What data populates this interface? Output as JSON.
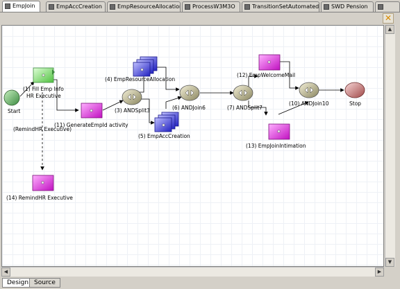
{
  "tabs": [
    {
      "label": "EmpJoin",
      "active": true
    },
    {
      "label": "EmpAccCreation"
    },
    {
      "label": "EmpResourceAllocation"
    },
    {
      "label": "ProcessW3M3O"
    },
    {
      "label": "TransitionSetAutomated"
    },
    {
      "label": "SWD Pension"
    }
  ],
  "close_label": "✕",
  "nodes": {
    "start": "Start",
    "fill": "(1) Fill Emp Info\nHR Executive",
    "gen": "(11) GenerateEmpId activity",
    "andsplit3": "(3) ANDSplit3",
    "res": "(4) EmpResourceAllocation",
    "acc": "(5) EmpAccCreation",
    "andjoin6": "(6) ANDJoin6",
    "andsplit7": "(7) ANDSplit7",
    "welcome": "(12) EmpWelcomeMail",
    "intimation": "(13) EmpJoinIntimation",
    "andjoin10": "(10) ANDJoin10",
    "stop": "Stop",
    "remind": "(14) RemindHR Executive",
    "remind_edge": "(RemindHR Executive)"
  },
  "bottom_tabs": [
    {
      "label": "Design",
      "active": true
    },
    {
      "label": "Source"
    }
  ]
}
